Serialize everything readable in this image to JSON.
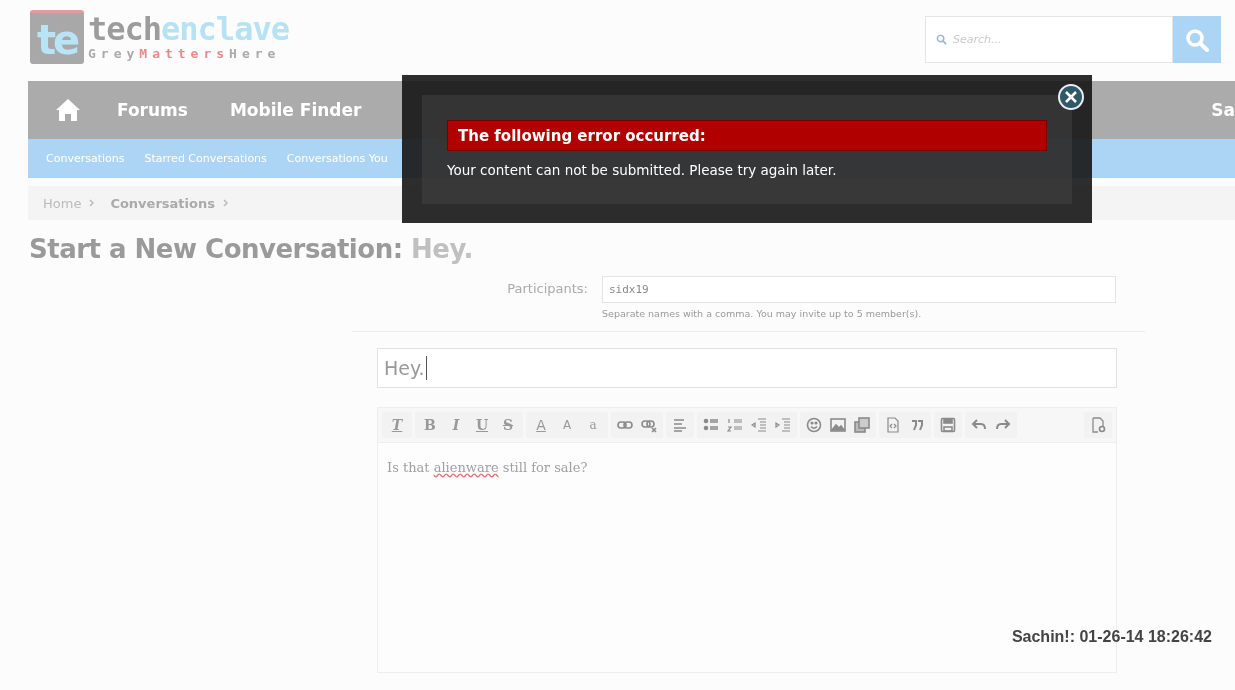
{
  "logo": {
    "mark": "te",
    "name_start": "tech",
    "name_end": "enclave",
    "tagline_start": "Grey",
    "tagline_middle": "Matters",
    "tagline_end": "Here"
  },
  "search": {
    "placeholder": "Search..."
  },
  "nav": [
    "Forums",
    "Mobile Finder"
  ],
  "nav_right": "Sa",
  "subnav": [
    "Conversations",
    "Starred Conversations",
    "Conversations You"
  ],
  "breadcrumb": [
    "Home",
    "Conversations"
  ],
  "page_title": {
    "prefix": "Start a New Conversation:",
    "subject": "Hey."
  },
  "participants": {
    "label": "Participants:",
    "value": "sidx19",
    "hint": "Separate names with a comma. You may invite up to 5 member(s)."
  },
  "title_field": {
    "value": "Hey."
  },
  "toolbar": [
    [
      {
        "kind": "clear",
        "label": "T"
      }
    ],
    [
      {
        "kind": "bold",
        "label": "B"
      },
      {
        "kind": "italic",
        "label": "I"
      },
      {
        "kind": "underline",
        "label": "U"
      },
      {
        "kind": "strike",
        "label": "S"
      }
    ],
    [
      {
        "kind": "color",
        "label": "A"
      },
      {
        "kind": "size",
        "label": "A"
      },
      {
        "kind": "font",
        "label": "a"
      }
    ],
    [
      {
        "kind": "link"
      },
      {
        "kind": "unlink"
      }
    ],
    [
      {
        "kind": "align"
      }
    ],
    [
      {
        "kind": "bullets"
      },
      {
        "kind": "numbers"
      },
      {
        "kind": "outdent"
      },
      {
        "kind": "indent"
      }
    ],
    [
      {
        "kind": "smiley"
      },
      {
        "kind": "image"
      },
      {
        "kind": "media"
      }
    ],
    [
      {
        "kind": "code"
      },
      {
        "kind": "quote"
      }
    ],
    [
      {
        "kind": "save"
      }
    ],
    [
      {
        "kind": "undo"
      },
      {
        "kind": "redo"
      }
    ],
    [
      {
        "kind": "draft"
      }
    ]
  ],
  "message": {
    "before": "Is that ",
    "misspelled": "alienware",
    "after": " still for sale?"
  },
  "timestamp": "Sachin!: 01-26-14 18:26:42",
  "error_dialog": {
    "title": "The following error occurred:",
    "message": "Your content can not be submitted. Please try again later."
  }
}
